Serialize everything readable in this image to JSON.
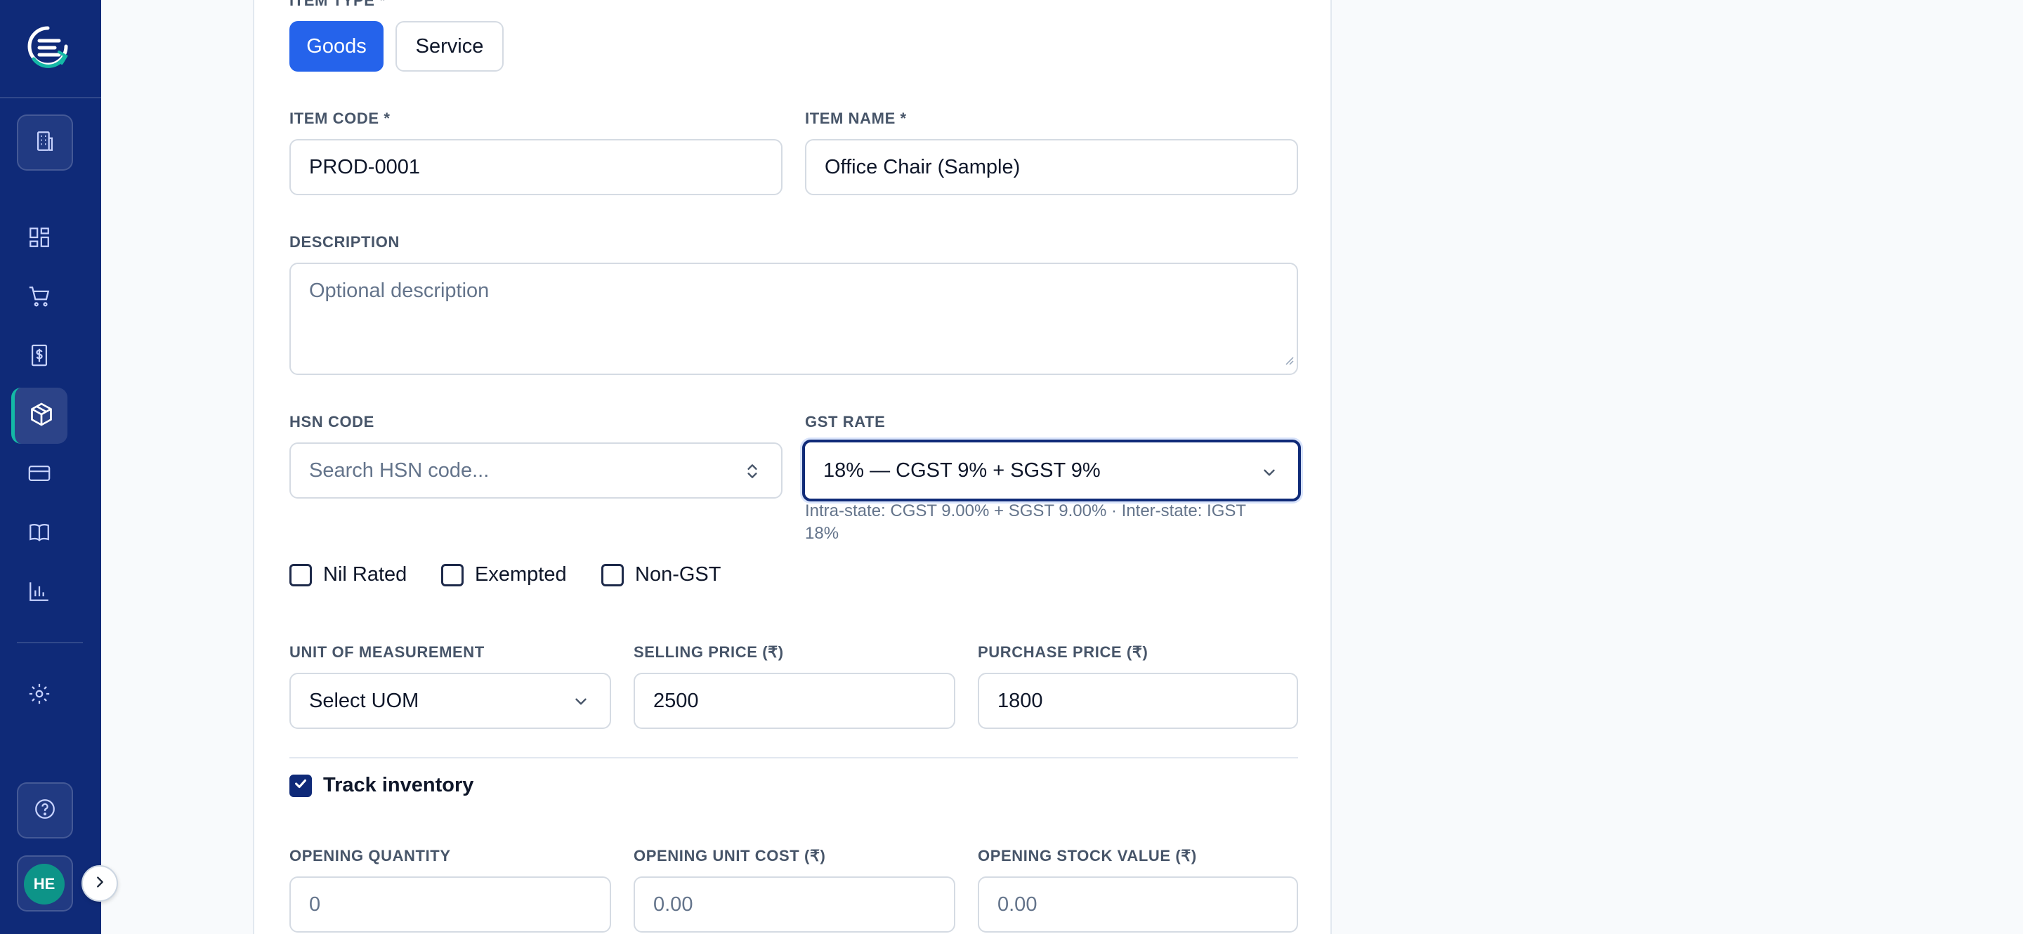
{
  "sidebar": {
    "avatar_initials": "HE",
    "accent_color": "#14b8a6",
    "background_color": "#0f2a78",
    "nav_icons": [
      "building-icon",
      "dashboard-icon",
      "cart-icon",
      "invoice-icon",
      "package-icon",
      "credit-card-icon",
      "book-icon",
      "chart-icon",
      "settings-icon",
      "help-icon"
    ],
    "active_item": "package-icon"
  },
  "form": {
    "item_type_label": "ITEM TYPE *",
    "item_type_options": [
      "Goods",
      "Service"
    ],
    "item_type_selected": "Goods",
    "item_code_label": "ITEM CODE *",
    "item_code_value": "PROD-0001",
    "item_name_label": "ITEM NAME *",
    "item_name_value": "Office Chair (Sample)",
    "description_label": "DESCRIPTION",
    "description_placeholder": "Optional description",
    "hsn_label": "HSN CODE",
    "hsn_placeholder": "Search HSN code...",
    "gst_label": "GST RATE",
    "gst_value": "18% — CGST 9% + SGST 9%",
    "gst_help_line1": "Intra-state: CGST 9.00% + SGST 9.00% · Inter-state: IGST",
    "gst_help_line2": "18%",
    "checkboxes": [
      {
        "label": "Nil Rated",
        "checked": false
      },
      {
        "label": "Exempted",
        "checked": false
      },
      {
        "label": "Non-GST",
        "checked": false
      }
    ],
    "uom_label": "UNIT OF MEASUREMENT",
    "uom_value": "Select UOM",
    "selling_price_label": "SELLING PRICE (₹)",
    "selling_price_value": "2500",
    "purchase_price_label": "PURCHASE PRICE (₹)",
    "purchase_price_value": "1800",
    "track_inventory_label": "Track inventory",
    "track_inventory_checked": true,
    "opening_qty_label": "OPENING QUANTITY",
    "opening_qty_placeholder": "0",
    "opening_unit_cost_label": "OPENING UNIT COST (₹)",
    "opening_unit_cost_placeholder": "0.00",
    "opening_stock_value_label": "OPENING STOCK VALUE (₹)",
    "opening_stock_value_placeholder": "0.00",
    "primary_color": "#2563eb"
  }
}
